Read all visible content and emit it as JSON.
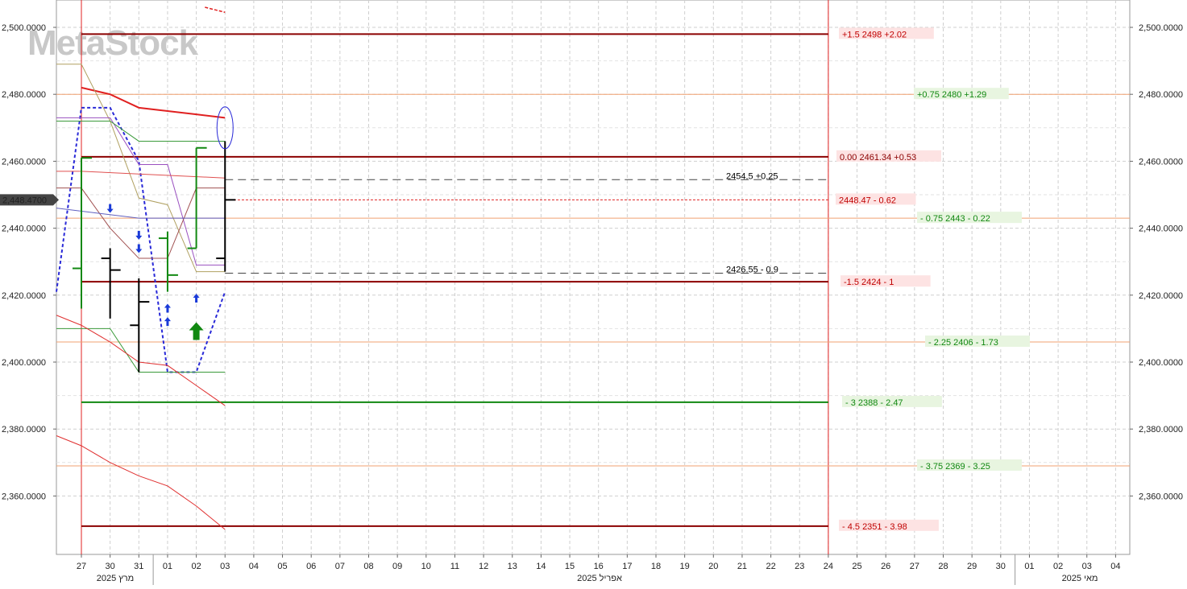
{
  "watermark": "MetaStock",
  "chart_data": {
    "type": "line",
    "ylim": [
      2345,
      2506
    ],
    "x_ticks": [
      "27",
      "30",
      "31",
      "01",
      "02",
      "03",
      "04",
      "05",
      "06",
      "07",
      "08",
      "09",
      "10",
      "11",
      "12",
      "13",
      "14",
      "15",
      "16",
      "17",
      "18",
      "19",
      "20",
      "21",
      "22",
      "23",
      "24",
      "25",
      "26",
      "27",
      "28",
      "29",
      "30",
      "01",
      "02",
      "03",
      "04"
    ],
    "month_labels": [
      "2025 מרץ",
      "2025 אפריל",
      "2025 מאי"
    ],
    "y_ticks": [
      2360,
      2380,
      2400,
      2420,
      2440,
      2460,
      2480,
      2500
    ],
    "y_tick_labels": [
      "2,360.0000",
      "2,380.0000",
      "2,400.0000",
      "2,420.0000",
      "2,440.0000",
      "2,460.0000",
      "2,480.0000",
      "2,500.0000"
    ],
    "last_price": 2448.47,
    "last_price_label": "2,448.4700",
    "grid": true,
    "levels": [
      {
        "y": 2498,
        "label": "+1.5   2498  +2.02",
        "line_color": "#8b0000",
        "text_color": "#c00000",
        "bg": "#fde3e3",
        "weight": 2
      },
      {
        "y": 2480,
        "label": "+0.75  2480  +1.29",
        "line_color": "#f0a070",
        "text_color": "#118811",
        "bg": "#e8f5e0",
        "weight": 1
      },
      {
        "y": 2461.34,
        "label": "0.00  2461.34  +0.53",
        "line_color": "#8b0000",
        "text_color": "#8b0000",
        "bg": "#fde3e3",
        "weight": 2
      },
      {
        "y": 2443,
        "label": "- 0.75  2443  - 0.22",
        "line_color": "#f0a070",
        "text_color": "#118811",
        "bg": "#e8f5e0",
        "weight": 1
      },
      {
        "y": 2424,
        "label": "-1.5   2424   - 1",
        "line_color": "#8b0000",
        "text_color": "#c00000",
        "bg": "#fde3e3",
        "weight": 2
      },
      {
        "y": 2406,
        "label": "- 2.25  2406  - 1.73",
        "line_color": "#f0a070",
        "text_color": "#118811",
        "bg": "#e8f5e0",
        "weight": 1
      },
      {
        "y": 2388,
        "label": "- 3   2388   - 2.47",
        "line_color": "#118811",
        "text_color": "#118811",
        "bg": "#e8f5e0",
        "weight": 2
      },
      {
        "y": 2369,
        "label": "- 3.75  2369  - 3.25",
        "line_color": "#f0a070",
        "text_color": "#118811",
        "bg": "#e8f5e0",
        "weight": 1
      },
      {
        "y": 2351,
        "label": "- 4.5  2351  - 3.98",
        "line_color": "#8b0000",
        "text_color": "#c00000",
        "bg": "#fde3e3",
        "weight": 2
      }
    ],
    "dashed_levels": [
      {
        "y": 2454.5,
        "label": "2454.5  +0.25",
        "color": "#444"
      },
      {
        "y": 2426.55,
        "label": "2426.55  - 0.9",
        "color": "#444"
      }
    ],
    "last_price_line": {
      "y": 2448.47,
      "label": "2448.47  - 0.62",
      "color": "#e02020"
    },
    "ohlc_bars": [
      {
        "x": 1,
        "open": 2431,
        "high": 2434,
        "low": 2413,
        "close": 2427.5
      },
      {
        "x": 2,
        "open": 2411,
        "high": 2425,
        "low": 2397,
        "close": 2418
      },
      {
        "x": 5,
        "open": 2431,
        "high": 2466,
        "low": 2427,
        "close": 2448.47
      }
    ],
    "green_bars": [
      {
        "x": 0,
        "open": 2428,
        "high": 2461,
        "low": 2416,
        "close": 2461
      },
      {
        "x": 3,
        "open": 2437,
        "high": 2439,
        "low": 2421,
        "close": 2426
      },
      {
        "x": 4,
        "open": 2434,
        "high": 2464,
        "low": 2434,
        "close": 2464
      }
    ],
    "series": [
      {
        "color": "#e02020",
        "width": 2,
        "dash": "",
        "x": [
          0,
          1,
          2,
          3,
          4,
          5
        ],
        "y": [
          2482,
          2480,
          2476,
          2475,
          2474,
          2473
        ]
      },
      {
        "color": "#2a2ad8",
        "width": 2,
        "dash": "4,3",
        "x": [
          -0.82,
          0,
          1,
          2,
          3,
          4,
          5
        ],
        "y": [
          2421,
          2476,
          2476,
          2460,
          2397,
          2397,
          2421
        ]
      },
      {
        "color": "#b0a060",
        "width": 1,
        "dash": "",
        "x": [
          -1,
          0,
          1,
          2,
          3,
          4,
          5
        ],
        "y": [
          2489,
          2489,
          2472,
          2449,
          2447,
          2427,
          2427
        ]
      },
      {
        "color": "#9a50c0",
        "width": 1,
        "dash": "",
        "x": [
          -1,
          1,
          2,
          3,
          4,
          5
        ],
        "y": [
          2473,
          2473,
          2459,
          2459,
          2429,
          2429
        ]
      },
      {
        "color": "#3a9a3a",
        "width": 1,
        "dash": "",
        "x": [
          -1,
          1,
          2,
          3,
          4,
          5
        ],
        "y": [
          2472,
          2472,
          2466,
          2466,
          2466,
          2466
        ]
      },
      {
        "color": "#a05050",
        "width": 1,
        "dash": "",
        "x": [
          -1,
          0,
          1,
          2,
          3,
          4,
          5
        ],
        "y": [
          2452,
          2452,
          2440,
          2431,
          2431,
          2452,
          2452
        ]
      },
      {
        "color": "#e05050",
        "width": 1,
        "dash": "",
        "x": [
          -1,
          0,
          5
        ],
        "y": [
          2457,
          2457,
          2455
        ]
      },
      {
        "color": "#6060c0",
        "width": 1,
        "dash": "",
        "x": [
          -1,
          2,
          5
        ],
        "y": [
          2446,
          2443,
          2443
        ]
      },
      {
        "color": "#3a9a3a",
        "width": 1,
        "dash": "",
        "x": [
          -1,
          1,
          2,
          3,
          4,
          5
        ],
        "y": [
          2410,
          2410,
          2397,
          2397,
          2397,
          2397
        ]
      },
      {
        "color": "#e03030",
        "width": 1,
        "dash": "",
        "x": [
          -1,
          0,
          1,
          2,
          3,
          4,
          5
        ],
        "y": [
          2414,
          2411,
          2406,
          2400,
          2399,
          2393,
          2387
        ]
      },
      {
        "color": "#e03030",
        "width": 1,
        "dash": "",
        "x": [
          -1,
          0,
          1,
          2,
          3,
          4,
          5
        ],
        "y": [
          2378,
          2375,
          2370,
          2366,
          2363,
          2357,
          2350
        ]
      }
    ],
    "arrows": [
      {
        "x": 1,
        "y": 2446,
        "dir": "down",
        "color": "#1a3ad8",
        "size": "small"
      },
      {
        "x": 2,
        "y": 2438,
        "dir": "down",
        "color": "#1a3ad8",
        "size": "small"
      },
      {
        "x": 2,
        "y": 2434,
        "dir": "down",
        "color": "#1a3ad8",
        "size": "small"
      },
      {
        "x": 3,
        "y": 2416,
        "dir": "up",
        "color": "#1a3ad8",
        "size": "small"
      },
      {
        "x": 3,
        "y": 2412,
        "dir": "up",
        "color": "#1a3ad8",
        "size": "small"
      },
      {
        "x": 4,
        "y": 2419,
        "dir": "up",
        "color": "#1a3ad8",
        "size": "small"
      },
      {
        "x": 4,
        "y": 2409,
        "dir": "up",
        "color": "#118811",
        "size": "big"
      }
    ],
    "ellipse": {
      "x": 5,
      "y": 2470,
      "color": "#2a2ad8"
    },
    "red_vlines": [
      0,
      26
    ],
    "corner_dashes": {
      "x": [
        4.3,
        5
      ],
      "y": [
        2506,
        2504.5
      ],
      "color": "#e02020"
    }
  }
}
